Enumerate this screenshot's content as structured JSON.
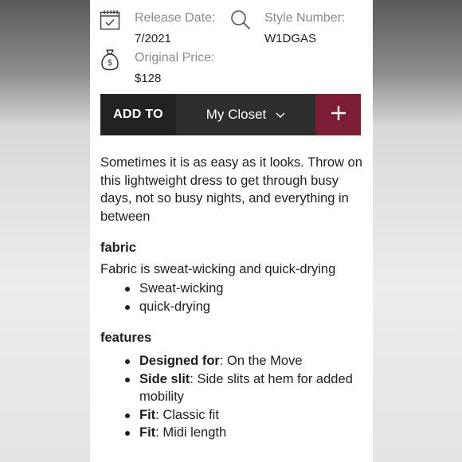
{
  "meta": {
    "release_label": "Release Date:",
    "release_value": "7/2021",
    "style_label": "Style Number:",
    "style_value": "W1DGAS",
    "price_label": "Original Price:",
    "price_value": "$128"
  },
  "icons": {
    "calendar": "calendar-check-icon",
    "search": "search-icon",
    "money": "money-bag-icon",
    "chevron": "chevron-down-icon",
    "plus": "plus-icon"
  },
  "add_bar": {
    "add_label": "ADD TO",
    "closet_value": "My Closet"
  },
  "description": "Sometimes it is as easy as it looks. Throw on this lightweight dress to get through busy days, not so busy nights, and everything in between",
  "fabric": {
    "title": "fabric",
    "text": "Fabric is sweat-wicking and quick-drying",
    "items": [
      "Sweat-wicking",
      "quick-drying"
    ]
  },
  "features": {
    "title": "features",
    "items": [
      {
        "label": "Designed for",
        "value": ": On the Move"
      },
      {
        "label": "Side slit",
        "value": ": Side slits at hem for added mobility"
      },
      {
        "label": "Fit",
        "value": ": Classic fit"
      },
      {
        "label": "Fit",
        "value": ": Midi length"
      }
    ]
  },
  "colors": {
    "accent": "#7d1d33",
    "bar_dark": "#222222",
    "select_bg": "#2e2e2e"
  }
}
